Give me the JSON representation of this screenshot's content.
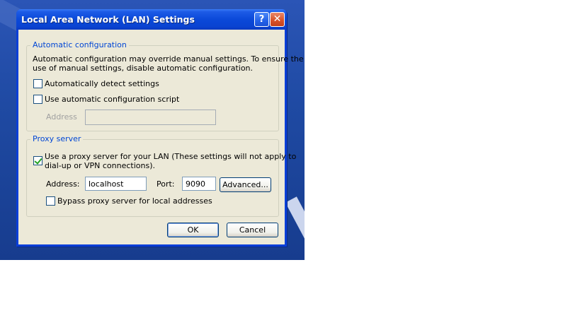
{
  "window": {
    "title": "Local Area Network (LAN) Settings",
    "help_glyph": "?",
    "close_glyph": "✕"
  },
  "auto_config": {
    "legend": "Automatic configuration",
    "description_line1": "Automatic configuration may override manual settings.  To ensure the",
    "description_line2": "use of manual settings, disable automatic configuration.",
    "detect_label": "Automatically detect settings",
    "detect_checked": false,
    "script_label": "Use automatic configuration script",
    "script_checked": false,
    "address_label": "Address",
    "address_value": ""
  },
  "proxy": {
    "legend": "Proxy server",
    "use_proxy_line1": "Use a proxy server for your LAN (These settings will not apply to",
    "use_proxy_line2": "dial-up or VPN connections).",
    "use_proxy_checked": true,
    "address_label": "Address:",
    "address_value": "localhost",
    "port_label": "Port:",
    "port_value": "9090",
    "advanced_label": "Advanced...",
    "bypass_label": "Bypass proxy server for local addresses",
    "bypass_checked": false
  },
  "buttons": {
    "ok": "OK",
    "cancel": "Cancel"
  }
}
